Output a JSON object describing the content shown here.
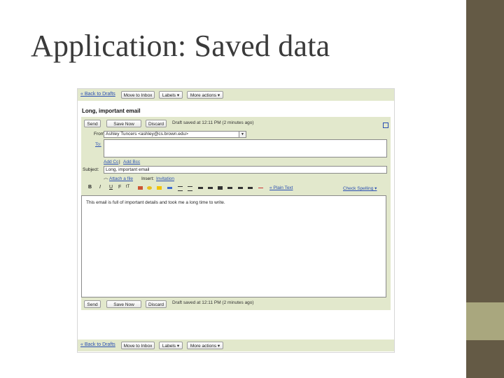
{
  "slide": {
    "title": "Application: Saved data"
  },
  "toolbar_top": {
    "back_link": "« Back to Drafts",
    "move_to_inbox": "Move to Inbox",
    "labels": "Labels ▾",
    "more_actions": "More actions ▾"
  },
  "email": {
    "subject_heading": "Long, important email"
  },
  "composer": {
    "send": "Send",
    "save_now": "Save Now",
    "discard": "Discard",
    "saved_status": "Draft saved at 12:11 PM (2 minutes ago)",
    "from_label": "From:",
    "from_value": "Ashley Tuncers <ashley@cs.brown.edu>",
    "to_label": "To:",
    "to_value": "",
    "add_cc": "Add Cc",
    "separator": "|",
    "add_bcc": "Add Bcc",
    "subject_label": "Subject:",
    "subject_value": "Long, important email",
    "attach_file": "Attach a file",
    "insert_label": "Insert:",
    "invitation": "Invitation",
    "plain_text": "« Plain Text",
    "check_spelling": "Check Spelling ▾",
    "body_text": "This email is full of important details and took me a long time to write.",
    "bottom_send": "Send",
    "bottom_save_now": "Save Now",
    "bottom_discard": "Discard",
    "bottom_saved_status": "Draft saved at 12:11 PM (2 minutes ago)"
  },
  "toolbar_bottom": {
    "back_link": "« Back to Drafts",
    "move_to_inbox": "Move to Inbox",
    "labels": "Labels ▾",
    "more_actions": "More actions ▾"
  },
  "format_toolbar": [
    "B",
    "I",
    "U",
    "F",
    "tT"
  ],
  "colors": {
    "sidebar_dark": "#645a45",
    "sidebar_light": "#a9a77e",
    "gmail_green": "#e2e8cc",
    "link_blue": "#2a4fb2"
  }
}
